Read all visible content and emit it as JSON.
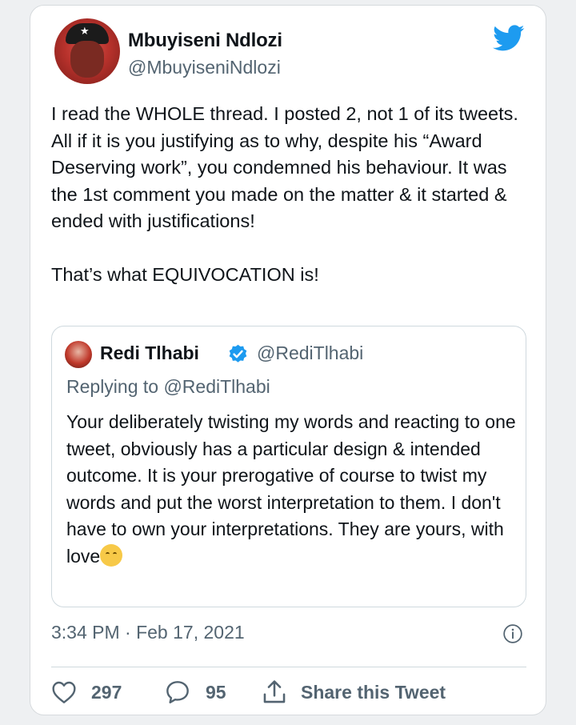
{
  "author": {
    "name": "Mbuyiseni Ndlozi",
    "handle": "@MbuyiseniNdlozi"
  },
  "tweet": {
    "text": "I read the WHOLE thread. I posted 2, not 1 of its tweets. All if it is you justifying as to why, despite his “Award Deserving work”, you condemned his behaviour. It was the 1st comment you made on the matter & it started & ended with justifications!\n\nThat’s what EQUIVOCATION is!",
    "timestamp": "3:34 PM · Feb 17, 2021"
  },
  "quoted": {
    "name": "Redi Tlhabi",
    "handle": "@RediTlhabi",
    "replying_to": "Replying to @RediTlhabi",
    "text": "Your deliberately twisting my words and reacting to one tweet, obviously has a particular design & intended outcome.  It is your prerogative of course to twist my words and put the worst interpretation to them. I don't have to own your interpretations. They are yours, with love"
  },
  "actions": {
    "likes": "297",
    "replies": "95",
    "share_label": "Share this Tweet"
  },
  "icons": {
    "brand": "twitter-bird-icon",
    "verified": "verified-badge-icon",
    "info": "info-icon",
    "like": "heart-icon",
    "reply": "comment-icon",
    "share": "share-icon",
    "emoji": "hugging-face-emoji"
  },
  "colors": {
    "twitter_blue": "#1d9bf0",
    "text_primary": "#0f1419",
    "text_secondary": "#536471",
    "border": "#cfd9de"
  }
}
